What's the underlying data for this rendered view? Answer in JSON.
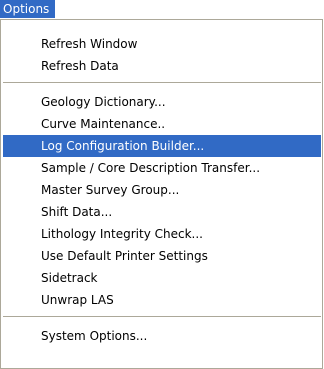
{
  "menubar": {
    "title": "Options"
  },
  "menu": {
    "group1": [
      {
        "label": "Refresh Window"
      },
      {
        "label": "Refresh Data"
      }
    ],
    "group2": [
      {
        "label": "Geology Dictionary..."
      },
      {
        "label": "Curve Maintenance.."
      },
      {
        "label": "Log Configuration Builder...",
        "highlighted": true
      },
      {
        "label": "Sample / Core Description Transfer..."
      },
      {
        "label": "Master Survey Group..."
      },
      {
        "label": "Shift Data..."
      },
      {
        "label": "Lithology Integrity Check..."
      },
      {
        "label": "Use Default Printer Settings"
      },
      {
        "label": "Sidetrack"
      },
      {
        "label": "Unwrap LAS"
      }
    ],
    "group3": [
      {
        "label": "System Options..."
      }
    ]
  },
  "colors": {
    "highlight": "#316ac5",
    "highlight_text": "#ffffff",
    "border": "#aca899",
    "background": "#ffffff"
  }
}
